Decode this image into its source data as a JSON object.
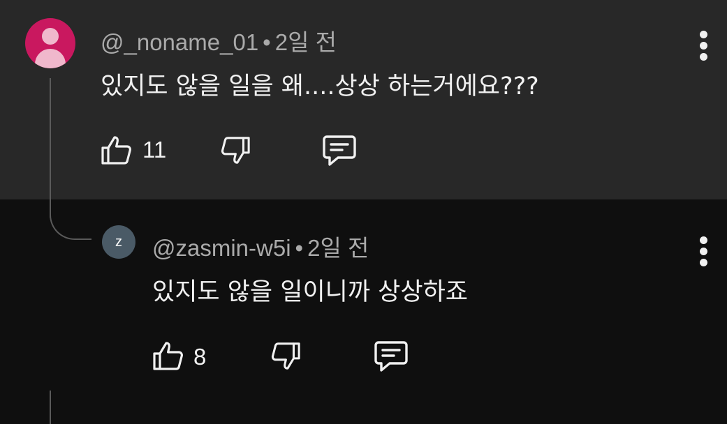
{
  "comment": {
    "handle": "@_noname_01",
    "separator": "•",
    "time": "2일 전",
    "text": "있지도 않을 일을 왜....상상 하는거에요???",
    "like_count": "11",
    "avatar_icon": "person-icon",
    "avatar_color": "#c9185f"
  },
  "reply": {
    "avatar_letter": "z",
    "avatar_color": "#4a5a66",
    "handle": "@zasmin-w5i",
    "separator": "•",
    "time": "2일 전",
    "text": "있지도 않을 일이니까 상상하죠",
    "like_count": "8"
  },
  "icons": [
    "thumbs-up-icon",
    "thumbs-down-icon",
    "reply-icon",
    "more-vert-icon"
  ],
  "colors": {
    "highlight_bg": "#282828",
    "page_bg": "#0f0f0f",
    "meta_text": "#aaaaaa"
  }
}
